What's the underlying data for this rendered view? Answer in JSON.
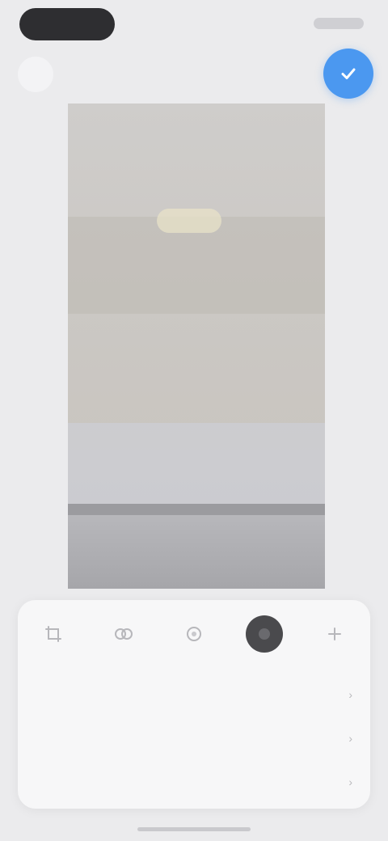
{
  "header": {
    "title": "",
    "done_label": ""
  },
  "toolbar": {
    "tools": [
      {
        "icon": "crop-icon"
      },
      {
        "icon": "adjust-icon"
      },
      {
        "icon": "filter-icon"
      },
      {
        "icon": "markup-icon",
        "active": true
      },
      {
        "icon": "more-icon"
      }
    ]
  },
  "adjustments": [
    {
      "label": "",
      "value": ""
    },
    {
      "label": "",
      "value": ""
    },
    {
      "label": "",
      "value": ""
    }
  ],
  "colors": {
    "accent": "#4b98f0",
    "background": "#ebebed",
    "sheet": "#f7f7f8"
  }
}
